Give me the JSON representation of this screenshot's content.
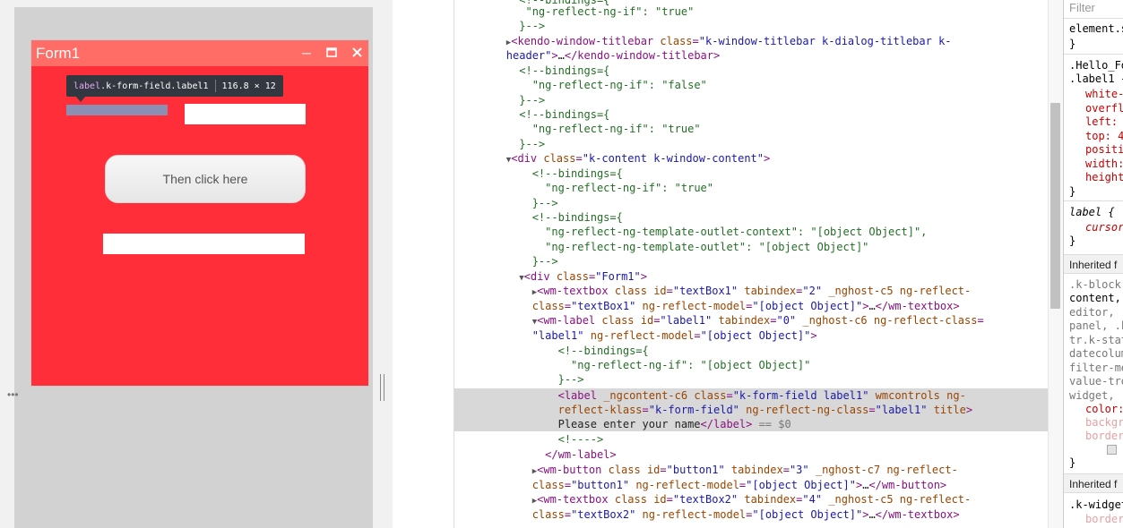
{
  "window": {
    "title": "Form1",
    "button1_label": "Then click here"
  },
  "tooltip": {
    "tag": "label",
    "classes": ".k-form-field.label1",
    "size": "116.8 × 12"
  },
  "elements": {
    "lines": [
      {
        "indent": "    ",
        "prefix": "  ",
        "html": "<span class='cm'>▼\"bindings\"={</span>"
      },
      {
        "indent": "     ",
        "prefix": "",
        "html": "<span class='cm'>\"ng-reflect-ng-if\": \"true\"</span>"
      },
      {
        "indent": "    ",
        "prefix": "",
        "html": "<span class='cm'>}--></span>"
      }
    ],
    "selected_text": "Please enter your name",
    "selected_suffix": " == $0"
  },
  "styles": {
    "filter_placeholder": "Filter",
    "inherited_1": "Inherited f",
    "inherited_2": "Inherited f"
  }
}
